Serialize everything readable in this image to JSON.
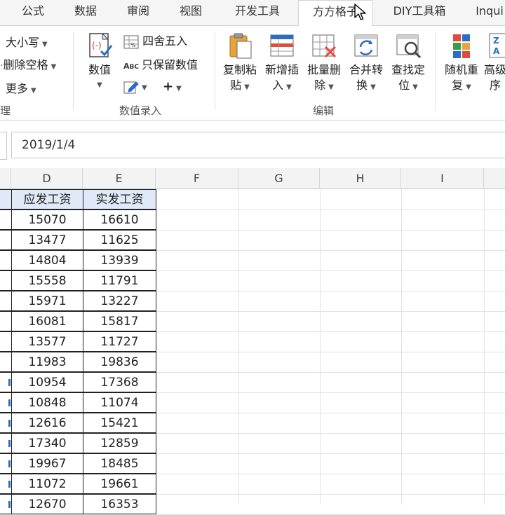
{
  "tabs": [
    "公式",
    "数据",
    "审阅",
    "视图",
    "开发工具",
    "方方格子",
    "DIY工具箱",
    "Inqui"
  ],
  "active_tab": "方方格子",
  "ribbon": {
    "group_text_processing": {
      "label": "理",
      "items": [
        "大小写",
        "删除空格",
        "更多"
      ]
    },
    "group_number_entry": {
      "label": "数值录入",
      "big_button": "数值",
      "small_items": [
        "四舍五入",
        "只保留数值"
      ],
      "plus": "+"
    },
    "group_edit": {
      "label": "编辑",
      "buttons": [
        {
          "line1": "复制粘",
          "line2": "贴"
        },
        {
          "line1": "新增插",
          "line2": "入"
        },
        {
          "line1": "批量删",
          "line2": "除"
        },
        {
          "line1": "合并转",
          "line2": "换"
        },
        {
          "line1": "查找定",
          "line2": "位"
        }
      ]
    },
    "group_more": {
      "buttons": [
        {
          "line1": "随机重",
          "line2": "复"
        },
        {
          "line1": "高级",
          "line2": "序"
        }
      ]
    }
  },
  "formula_bar": {
    "value": "2019/1/4"
  },
  "columns": [
    "D",
    "E",
    "F",
    "G",
    "H",
    "I"
  ],
  "table": {
    "headers": [
      "应发工资",
      "实发工资"
    ],
    "rows": [
      [
        "15070",
        "16610"
      ],
      [
        "13477",
        "11625"
      ],
      [
        "14804",
        "13939"
      ],
      [
        "15558",
        "11791"
      ],
      [
        "15971",
        "13227"
      ],
      [
        "16081",
        "15817"
      ],
      [
        "13577",
        "11727"
      ],
      [
        "11983",
        "19836"
      ],
      [
        "10954",
        "17368"
      ],
      [
        "10848",
        "11074"
      ],
      [
        "12616",
        "15421"
      ],
      [
        "17340",
        "12859"
      ],
      [
        "19967",
        "18485"
      ],
      [
        "11072",
        "19661"
      ],
      [
        "12670",
        "16353"
      ]
    ]
  },
  "colors": {
    "accent_blue": "#2b6cc4",
    "header_bg": "#dfe9f7",
    "grid_line": "#e1e1e1"
  }
}
